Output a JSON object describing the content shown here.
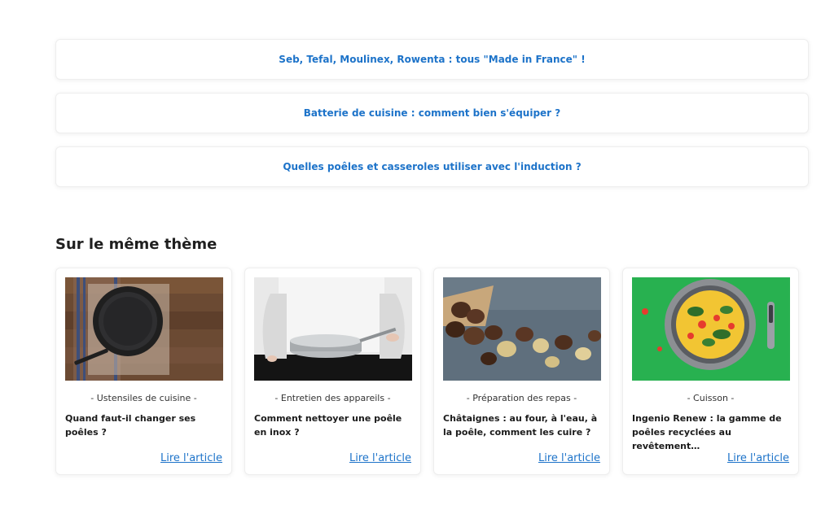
{
  "related_links": [
    {
      "label": "Seb, Tefal, Moulinex, Rowenta : tous \"Made in France\" !"
    },
    {
      "label": "Batterie de cuisine : comment bien s'équiper ?"
    },
    {
      "label": "Quelles poêles et casseroles utiliser avec l'induction ?"
    }
  ],
  "section": {
    "title": "Sur le même thème"
  },
  "articles": [
    {
      "category": "- Ustensiles de cuisine -",
      "title": "Quand faut-il changer ses poêles ?",
      "link": "Lire l'article"
    },
    {
      "category": "- Entretien des appareils -",
      "title": "Comment nettoyer une poêle en inox ?",
      "link": "Lire l'article"
    },
    {
      "category": "- Préparation des repas -",
      "title": "Châtaignes : au four, à l'eau, à la poêle, comment les cuire ?",
      "link": "Lire l'article"
    },
    {
      "category": "- Cuisson -",
      "title": "Ingenio Renew : la gamme de poêles recyclées au revêtement…",
      "link": "Lire l'article"
    }
  ],
  "colors": {
    "link": "#1d73c9",
    "card_border": "#eeeeee"
  }
}
